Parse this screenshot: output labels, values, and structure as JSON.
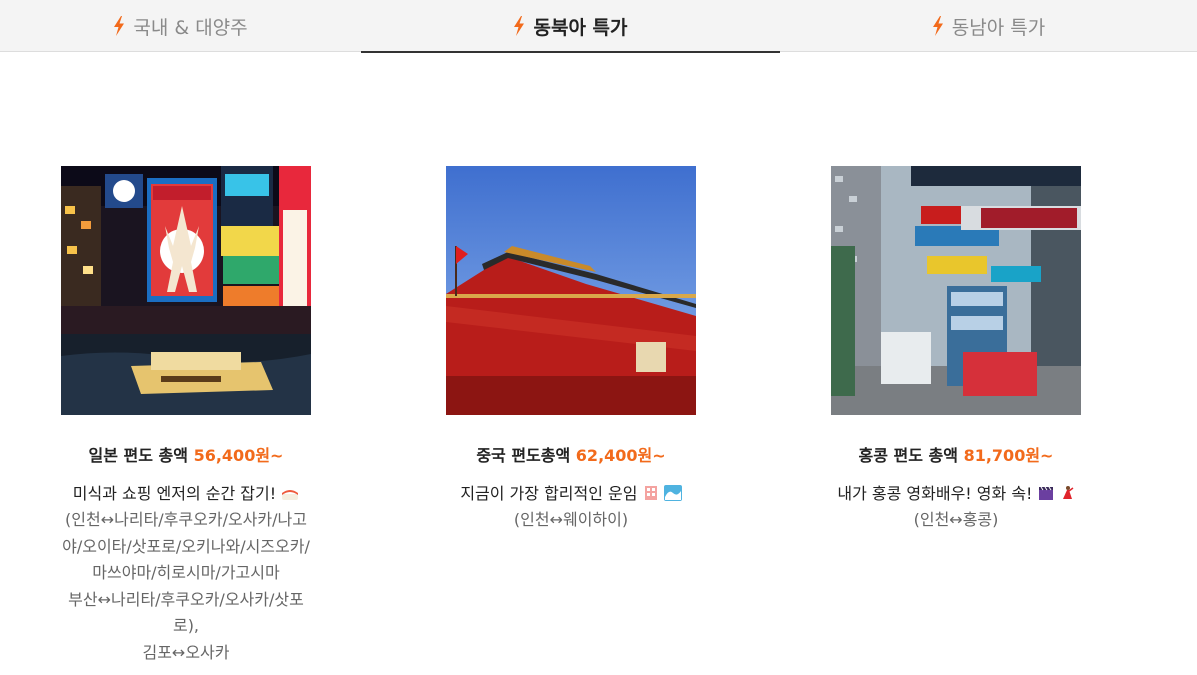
{
  "tabs": [
    {
      "label": "국내 & 대양주",
      "icon": "lightning-icon",
      "active": false
    },
    {
      "label": "동북아 특가",
      "icon": "lightning-icon",
      "active": true
    },
    {
      "label": "동남아 특가",
      "icon": "lightning-icon",
      "active": false
    }
  ],
  "colors": {
    "accent": "#f26a1b",
    "tab_bg": "#f4f4f4",
    "active_underline": "#333333"
  },
  "cards": [
    {
      "title": "일본 편도 총액",
      "price": "56,400원~",
      "tagline": "미식과 쇼핑 엔저의 순간 잡기!",
      "tagline_icon": "sushi-icon",
      "routes": [
        "(인천↔나리타/후쿠오카/오사카/나고야/오이타/삿포로/오키나와/시즈오카/마쓰야마/히로시마/가고시마",
        "부산↔나리타/후쿠오카/오사카/삿포로),",
        "김포↔오사카"
      ]
    },
    {
      "title": "중국 편도총액",
      "price": "62,400원~",
      "tagline": "지금이 가장 합리적인 운임",
      "tagline_icon": "hotel-wave-icons",
      "routes": [
        "(인천↔웨이하이)"
      ]
    },
    {
      "title": "홍콩 편도 총액",
      "price": "81,700원~",
      "tagline": "내가 홍콩 영화배우! 영화 속!",
      "tagline_icon": "clapper-dancer-icons",
      "routes": [
        "(인천↔홍콩)"
      ]
    }
  ]
}
